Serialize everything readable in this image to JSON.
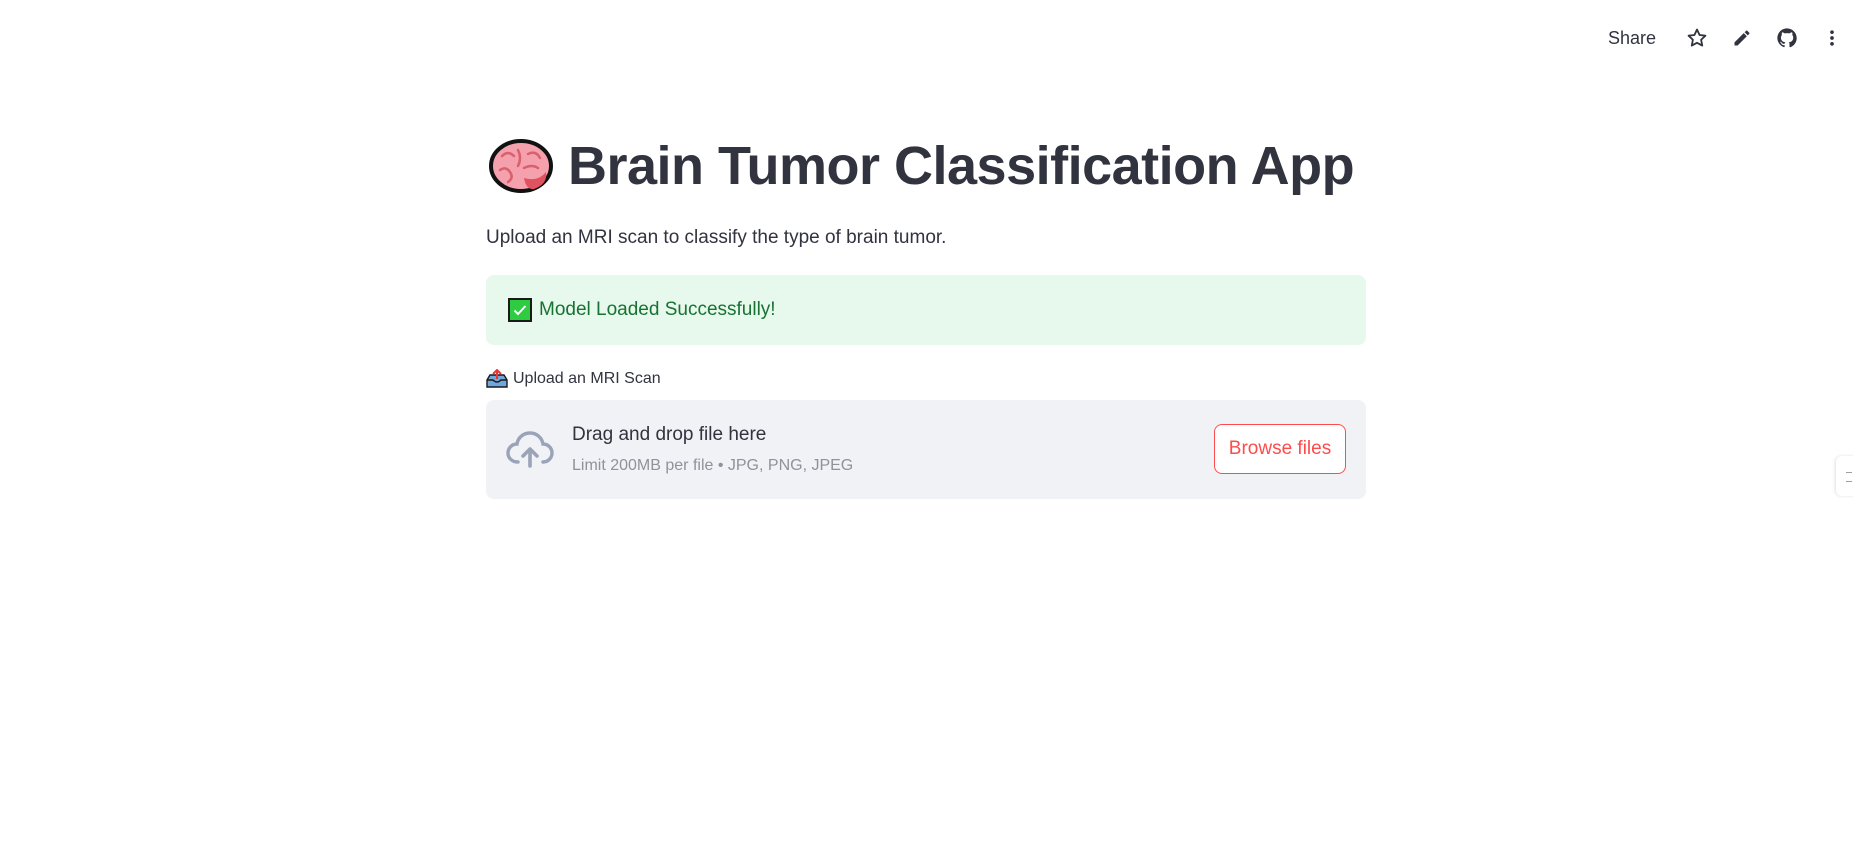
{
  "header": {
    "share_label": "Share",
    "icons": [
      "star-icon",
      "pencil-icon",
      "github-icon",
      "more-vertical-icon"
    ]
  },
  "main": {
    "title_emoji": "brain-emoji",
    "title": "Brain Tumor Classification App",
    "subtitle": "Upload an MRI scan to classify the type of brain tumor."
  },
  "status": {
    "text": "Model Loaded Successfully!",
    "icon": "check-mark-button-icon",
    "background": "#e7f8ec",
    "text_color": "#177233"
  },
  "uploader": {
    "label": "Upload an MRI Scan",
    "label_icon": "outbox-tray-icon",
    "drop_text": "Drag and drop file here",
    "limit_text": "Limit 200MB per file • JPG, PNG, JPEG",
    "browse_label": "Browse files",
    "accent": "#ff4b4b"
  }
}
